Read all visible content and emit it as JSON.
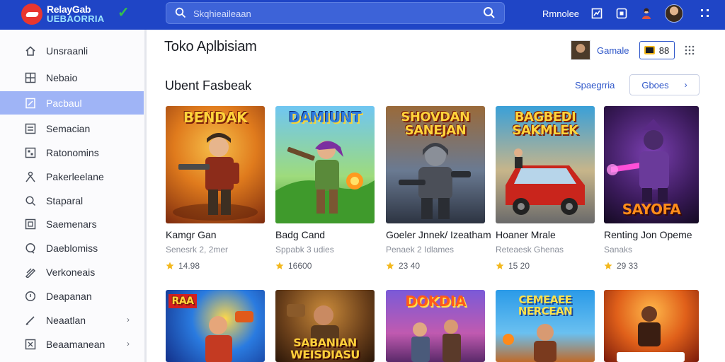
{
  "header": {
    "logo_line1": "RelayGab",
    "logo_line2": "UEBAORRIA",
    "search_placeholder": "Skqhieaileaan",
    "link": "Rmnolee"
  },
  "sidebar": {
    "items": [
      {
        "label": "Unsraanli",
        "icon": "home-icon"
      },
      {
        "label": "Nebaio",
        "icon": "grid-icon"
      },
      {
        "label": "Pacbaul",
        "icon": "bookmark-icon",
        "active": true
      },
      {
        "label": "Semacian",
        "icon": "list-icon"
      },
      {
        "label": "Ratonomins",
        "icon": "apps-icon"
      },
      {
        "label": "Pakerleelane",
        "icon": "person-icon"
      },
      {
        "label": "Staparal",
        "icon": "search-icon"
      },
      {
        "label": "Saemenars",
        "icon": "square-icon"
      },
      {
        "label": "Daeblomiss",
        "icon": "chat-icon"
      },
      {
        "label": "Verkoneais",
        "icon": "pen-icon"
      },
      {
        "label": "Deapanan",
        "icon": "info-icon"
      },
      {
        "label": "Neaatlan",
        "icon": "edit-icon",
        "chevron": true
      },
      {
        "label": "Beaamanean",
        "icon": "box-icon",
        "chevron": true
      }
    ]
  },
  "main": {
    "title": "Toko Aplbisiam",
    "title_link": "Gamale",
    "coins": "88",
    "section_title": "Ubent Fasbeak",
    "section_link": "Spaegrria",
    "section_button": "Gboes"
  },
  "games_row1": [
    {
      "thumb_title": "BENDAK",
      "name": "Kamgr Gan",
      "sub": "Senesrk 2, 2mer",
      "rating": "14.98"
    },
    {
      "thumb_title": "DAMIUNT",
      "name": "Badg Cand",
      "sub": "Sppabk 3 udies",
      "rating": "16600"
    },
    {
      "thumb_title": "SHOVDAN SANEJAN",
      "name": "Goeler Jnnek/ Izeatham",
      "sub": "Penaek 2 Idlames",
      "rating": "23 40"
    },
    {
      "thumb_title": "BAGBEDI SAKMLEK",
      "name": "Hoaner Mrale",
      "sub": "Reteaesk Ghenas",
      "rating": "15 20"
    },
    {
      "thumb_title": "SAYOFA",
      "name": "Renting Jon Opeme",
      "sub": "Sanaks",
      "rating": "29 33"
    }
  ],
  "games_row2": [
    {
      "thumb_title": "RAA"
    },
    {
      "thumb_title": "SABANIAN WEISDIASU"
    },
    {
      "thumb_title": "DOKDIA"
    },
    {
      "thumb_title": "CEMEAEE NERCEAN"
    },
    {
      "thumb_title": ""
    }
  ],
  "colors": {
    "topbar": "#1f45c6",
    "accent": "#2e56c9",
    "sidebar_active": "#9fb4f6",
    "rating_star": "#f3b81d"
  }
}
